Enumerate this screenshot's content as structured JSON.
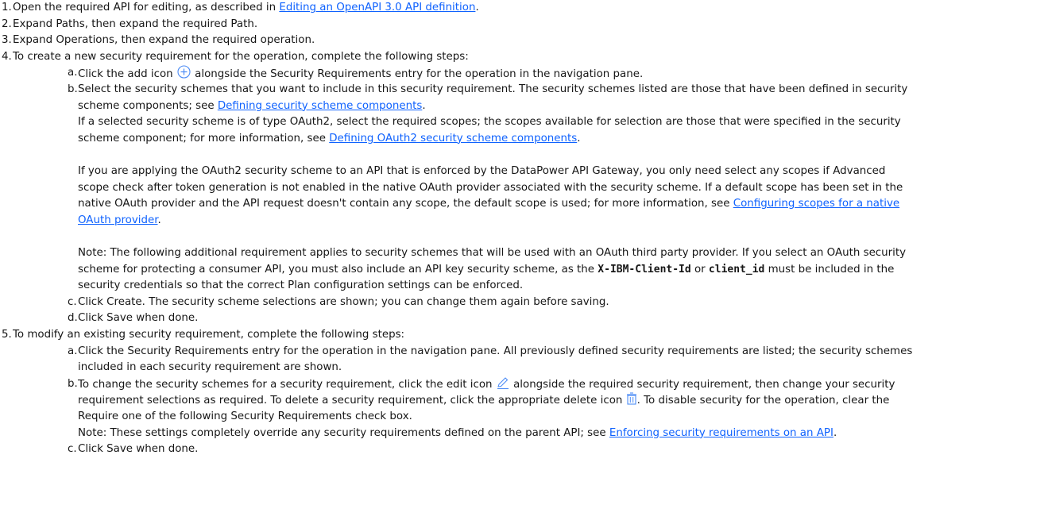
{
  "step1": {
    "num": "1.",
    "pre": "Open the required API for editing, as described in ",
    "link": "Editing an OpenAPI 3.0 API definition",
    "post": "."
  },
  "step2": {
    "num": "2.",
    "text": "Expand Paths, then expand the required Path."
  },
  "step3": {
    "num": "3.",
    "text": "Expand Operations, then expand the required operation."
  },
  "step4": {
    "num": "4.",
    "text": "To create a new security requirement for the operation, complete the following steps:"
  },
  "step4a": {
    "num": "a.",
    "pre": "Click the add icon",
    "post": "alongside the Security Requirements entry for the operation in the navigation pane."
  },
  "step4b": {
    "num": "b.",
    "l1": "Select the security schemes that you want to include in this security requirement. The security schemes listed are those that have been defined in security",
    "l2_pre": "scheme components; see ",
    "l2_link": "Defining security scheme components",
    "l2_post": ".",
    "l3": "If a selected security scheme is of type OAuth2, select the required scopes; the scopes available for selection are those that were specified in the security",
    "l4_pre": "scheme component; for more information, see ",
    "l4_link": "Defining OAuth2 security scheme components",
    "l4_post": ".",
    "p2_l1": "If you are applying the OAuth2 security scheme to an API that is enforced by the DataPower API Gateway, you only need select any scopes if Advanced",
    "p2_l2": "scope check after token generation is not enabled in the native OAuth provider associated with the security scheme. If a default scope has been set in the",
    "p2_l3_pre": "native OAuth provider and the API request doesn't contain any scope, the default scope is used; for more information, see ",
    "p2_l3_link": "Configuring scopes for a native",
    "p2_l4_link": "OAuth provider",
    "p2_l4_post": ".",
    "note_l1": "Note: The following additional requirement applies to security schemes that will be used with an OAuth third party provider. If you select an OAuth security",
    "note_l2_pre": "scheme for protecting a consumer API, you must also include an API key security scheme, as the ",
    "note_code1": "X-IBM-Client-Id",
    "note_or": " or ",
    "note_code2": "client_id",
    "note_l2_post": " must be included in the",
    "note_l3": "security credentials so that the correct Plan configuration settings can be enforced."
  },
  "step4c": {
    "num": "c.",
    "text": "Click Create. The security scheme selections are shown; you can change them again before saving."
  },
  "step4d": {
    "num": "d.",
    "text": "Click Save when done."
  },
  "step5": {
    "num": "5.",
    "text": "To modify an existing security requirement, complete the following steps:"
  },
  "step5a": {
    "num": "a.",
    "l1": "Click the Security Requirements entry for the operation in the navigation pane. All previously defined security requirements are listed; the security schemes",
    "l2": "included in each security requirement are shown."
  },
  "step5b": {
    "num": "b.",
    "l1_pre": "To change the security schemes for a security requirement, click the edit icon",
    "l1_post": "alongside the required security requirement, then change your security",
    "l2_pre": "requirement selections as required. To delete a security requirement, click the appropriate delete icon",
    "l2_post": ". To disable security for the operation, clear the",
    "l3": "Require one of the following Security Requirements check box.",
    "l4_pre": "Note: These settings completely override any security requirements defined on the parent API; see ",
    "l4_link": "Enforcing security requirements on an API",
    "l4_post": "."
  },
  "step5c": {
    "num": "c.",
    "text": "Click Save when done."
  },
  "icons": {
    "add": "add-circle-icon",
    "edit": "edit-pencil-icon",
    "delete": "trash-icon"
  },
  "colors": {
    "link": "#0f62fe",
    "icon": "#4c8bf5",
    "text": "#161616"
  }
}
